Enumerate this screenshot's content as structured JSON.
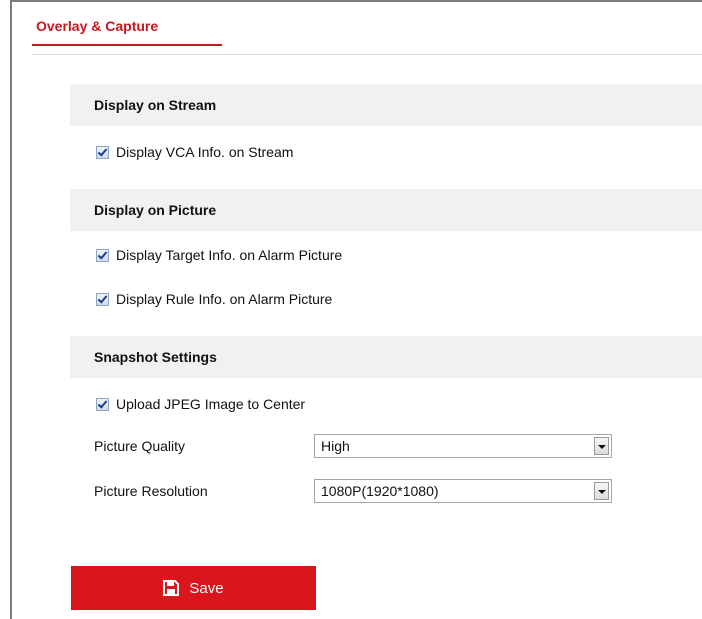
{
  "tab": {
    "label": "Overlay & Capture"
  },
  "sections": {
    "stream": {
      "title": "Display on Stream",
      "items": [
        {
          "label": "Display VCA Info. on Stream",
          "checked": true
        }
      ]
    },
    "picture": {
      "title": "Display on Picture",
      "items": [
        {
          "label": "Display Target Info. on Alarm Picture",
          "checked": true
        },
        {
          "label": "Display Rule Info. on Alarm Picture",
          "checked": true
        }
      ]
    },
    "snapshot": {
      "title": "Snapshot Settings",
      "items": [
        {
          "label": "Upload JPEG Image to Center",
          "checked": true
        }
      ],
      "quality": {
        "label": "Picture Quality",
        "value": "High"
      },
      "resolution": {
        "label": "Picture Resolution",
        "value": "1080P(1920*1080)"
      }
    }
  },
  "save": {
    "label": "Save",
    "icon": "save-icon"
  },
  "colors": {
    "accent": "#d9161d",
    "section_bg": "#f1f1f1"
  }
}
